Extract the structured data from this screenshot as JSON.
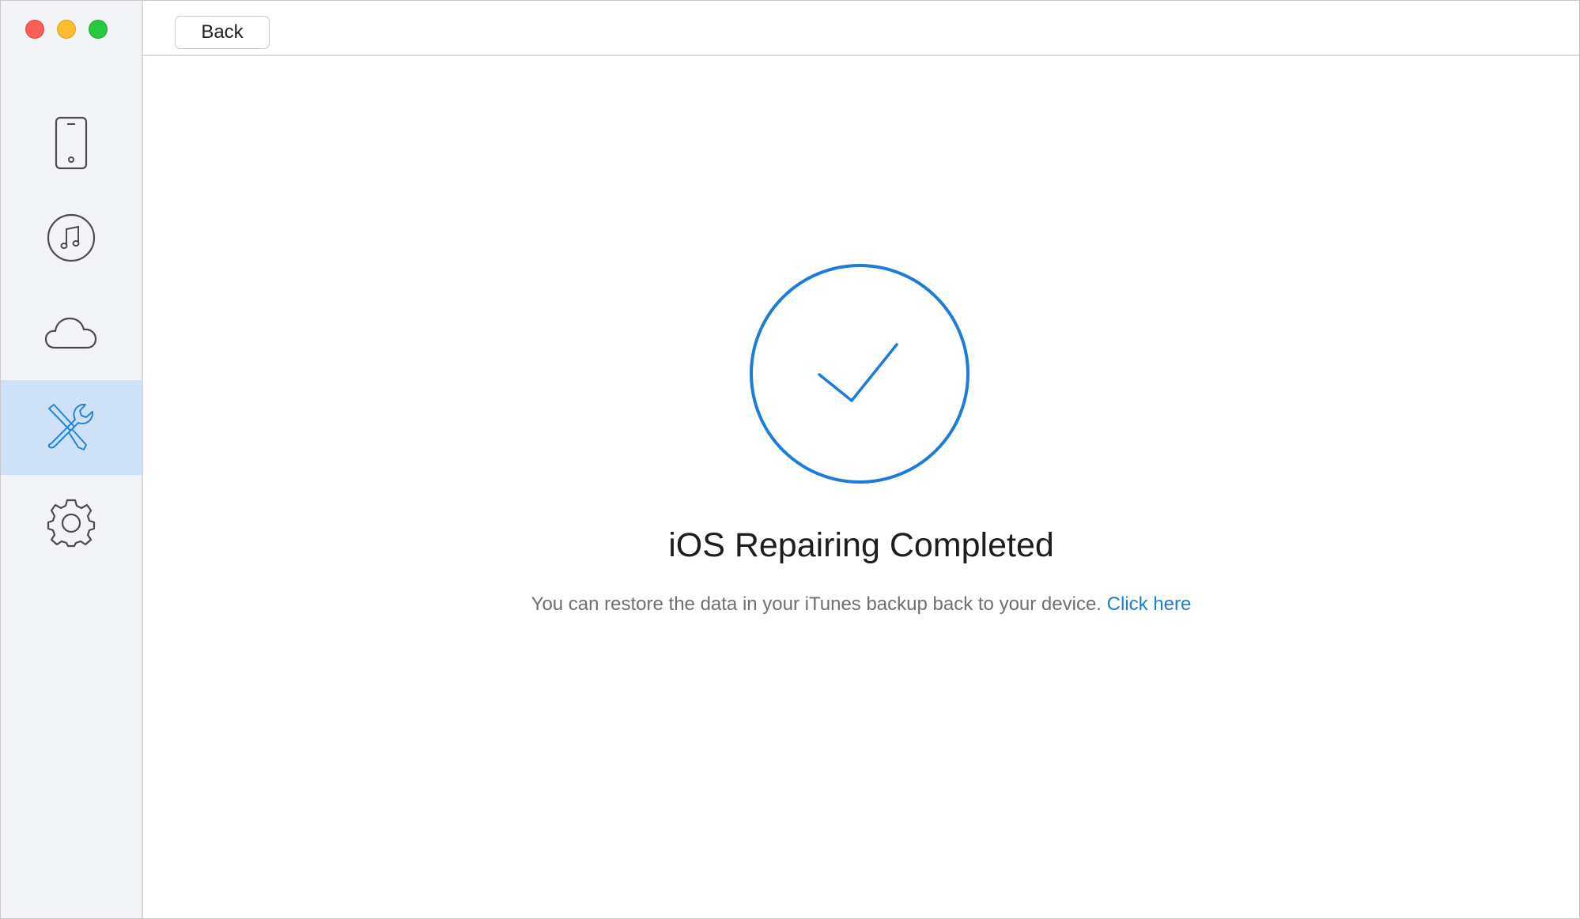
{
  "window": {
    "controls": [
      "close",
      "minimize",
      "zoom"
    ]
  },
  "sidebar": {
    "items": [
      {
        "name": "device",
        "icon": "iphone-icon",
        "active": false
      },
      {
        "name": "itunes",
        "icon": "music-note-icon",
        "active": false
      },
      {
        "name": "icloud",
        "icon": "cloud-icon",
        "active": false
      },
      {
        "name": "ios-repair",
        "icon": "tools-icon",
        "active": true
      },
      {
        "name": "settings",
        "icon": "gear-icon",
        "active": false
      }
    ]
  },
  "toolbar": {
    "back_label": "Back"
  },
  "main": {
    "status_icon": "checkmark-circle-icon",
    "title": "iOS Repairing Completed",
    "message": "You can restore the data in your iTunes backup back to your device.",
    "link_label": "Click here"
  },
  "colors": {
    "accent": "#1b7cd9",
    "sidebar_bg": "#f3f4f8",
    "sidebar_active": "#cfe1f6",
    "icon_gray": "#4a4a4f"
  }
}
